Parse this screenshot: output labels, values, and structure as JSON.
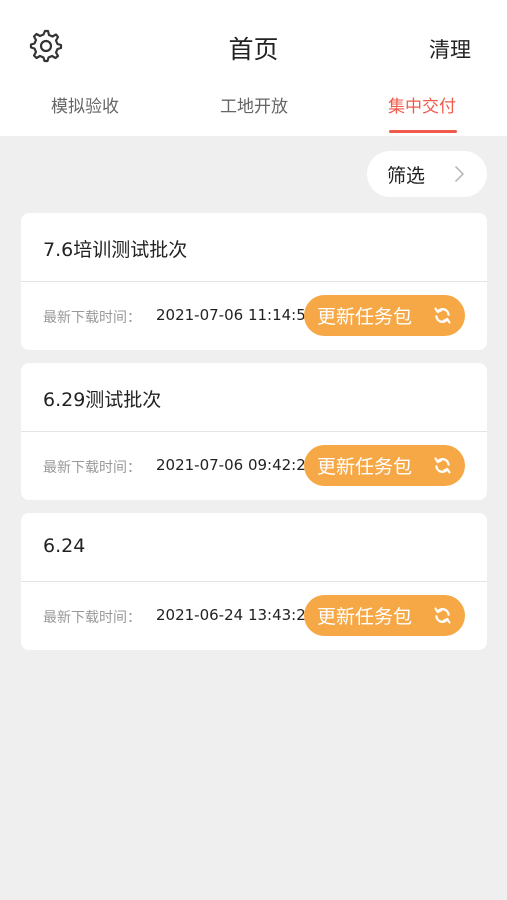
{
  "header": {
    "title": "首页",
    "settings_icon": "gear-icon",
    "clear_label": "清理"
  },
  "tabs": [
    {
      "label": "模拟验收",
      "active": false
    },
    {
      "label": "工地开放",
      "active": false
    },
    {
      "label": "集中交付",
      "active": true
    }
  ],
  "filter": {
    "label": "筛选",
    "icon": "chevron-right-icon"
  },
  "colors": {
    "accent": "#f05a4a",
    "button": "#f7a846",
    "background": "#efefef"
  },
  "batches": [
    {
      "title": "7.6培训测试批次",
      "download_label": "最新下载时间：",
      "download_time": "2021-07-06 11:14:59",
      "button_label": "更新任务包"
    },
    {
      "title": "6.29测试批次",
      "download_label": "最新下载时间：",
      "download_time": "2021-07-06 09:42:25",
      "button_label": "更新任务包"
    },
    {
      "title": "6.24",
      "download_label": "最新下载时间：",
      "download_time": "2021-06-24 13:43:25",
      "button_label": "更新任务包"
    }
  ]
}
